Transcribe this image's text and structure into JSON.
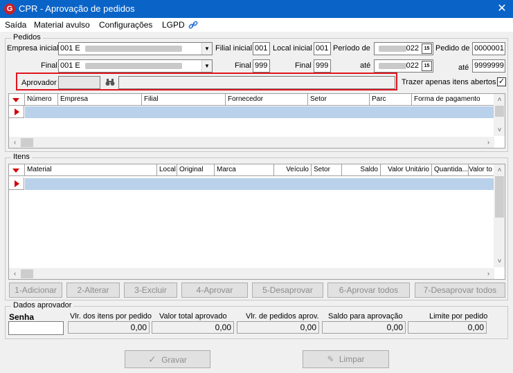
{
  "window": {
    "title": "CPR - Aprovação de pedidos",
    "logo": "G",
    "close": "✕"
  },
  "menu": {
    "items": [
      "Saída",
      "Material avulso",
      "Configurações",
      "LGPD"
    ]
  },
  "pedidos": {
    "legend": "Pedidos",
    "empresa_inicial_label": "Empresa inicial",
    "empresa_inicial_value": "001 E",
    "final_label": "Final",
    "empresa_final_value": "001 E",
    "filial_inicial_label": "Filial inicial",
    "filial_inicial_value": "001",
    "filial_final_label": "Final",
    "filial_final_value": "999",
    "local_inicial_label": "Local inicial",
    "local_inicial_value": "001",
    "local_final_label": "Final",
    "local_final_value": "999",
    "periodo_label": "Período de",
    "periodo_de_suffix": "022",
    "ate_label": "até",
    "periodo_ate_suffix": "022",
    "pedido_de_label": "Pedido de",
    "pedido_de_value": "0000001",
    "pedido_ate_label": "até",
    "pedido_ate_value": "9999999",
    "aprovador_label": "Aprovador",
    "trazer_label": "Trazer apenas itens abertos",
    "trazer_checked": "✓",
    "columns": [
      "Número",
      "Empresa",
      "Filial",
      "Fornecedor",
      "Setor",
      "Parc",
      "Forma de pagamento"
    ]
  },
  "itens": {
    "legend": "Itens",
    "columns": [
      "Material",
      "Local",
      "Original",
      "Marca",
      "Veículo",
      "Setor",
      "Saldo",
      "Valor Unitário",
      "Quantida...",
      "Valor to"
    ]
  },
  "actions": {
    "adicionar": "1-Adicionar",
    "alterar": "2-Alterar",
    "excluir": "3-Excluir",
    "aprovar": "4-Aprovar",
    "desaprovar": "5-Desaprovar",
    "aprovar_todos": "6-Aprovar todos",
    "desaprovar_todos": "7-Desaprovar todos"
  },
  "dados": {
    "legend": "Dados aprovador",
    "senha_label": "Senha",
    "vlr_itens_label": "Vlr. dos itens por pedido",
    "vlr_itens_value": "0,00",
    "valor_total_label": "Valor total aprovado",
    "valor_total_value": "0,00",
    "vlr_pedidos_label": "Vlr. de pedidos aprov.",
    "vlr_pedidos_value": "0,00",
    "saldo_label": "Saldo para aprovação",
    "saldo_value": "0,00",
    "limite_label": "Limite por pedido",
    "limite_value": "0,00"
  },
  "footer": {
    "gravar": "Gravar",
    "limpar": "Limpar"
  },
  "colors": {
    "titlebar": "#0a64c8",
    "selection": "#b9d1ea",
    "highlight": "#e0141e"
  }
}
